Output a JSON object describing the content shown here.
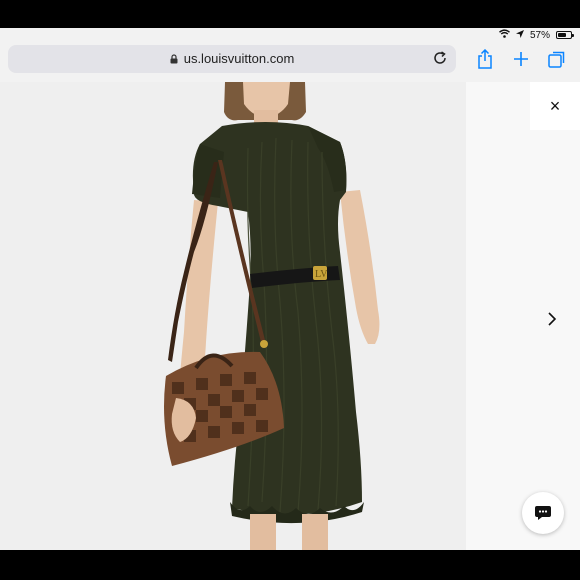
{
  "status": {
    "battery_percent": "57%",
    "battery_level": 0.57,
    "icons": [
      "wifi-icon",
      "location-arrow-icon",
      "battery-icon"
    ]
  },
  "browser": {
    "url": "us.louisvuitton.com",
    "url_icon": "lock-icon",
    "reload_icon": "reload-icon",
    "toolbar_icons": [
      "share-icon",
      "plus-icon",
      "tabs-icon"
    ]
  },
  "colors": {
    "url_bar_bg": "#e3e3e8",
    "accent": "#0a84ff",
    "dress": "#2e3320",
    "bag": "#7a4c2f"
  },
  "page": {
    "close_label": "×",
    "next_icon": "chevron-right-icon",
    "chat_icon": "chat-bubble-icon"
  }
}
